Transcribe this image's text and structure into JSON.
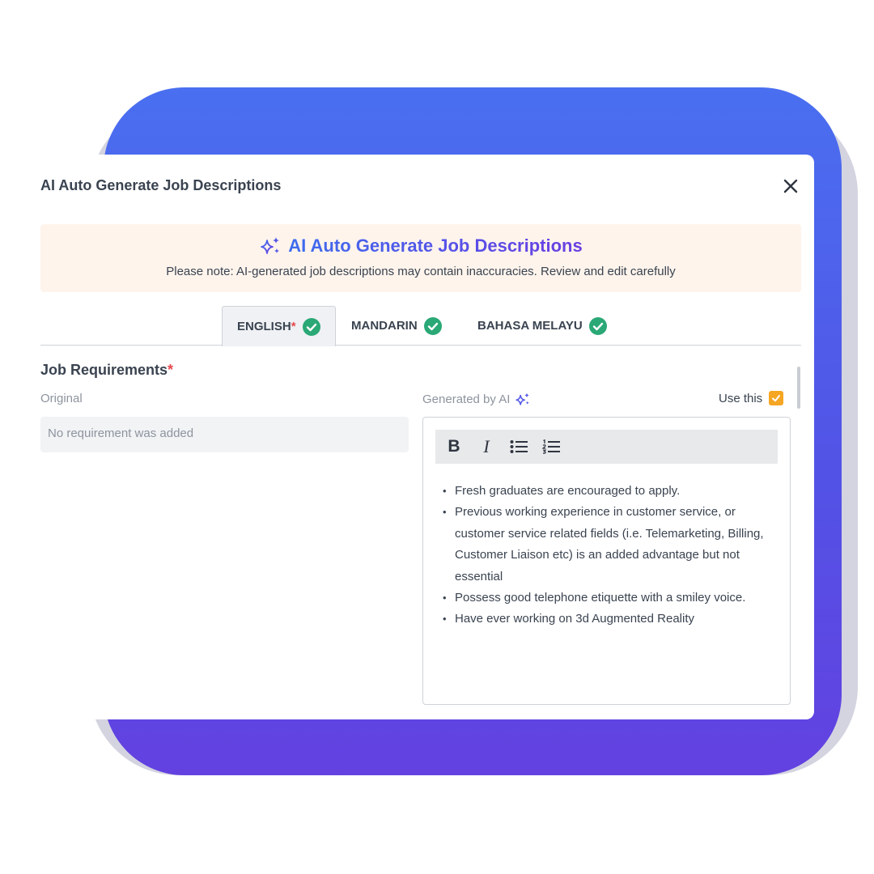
{
  "modal": {
    "title": "AI Auto Generate Job Descriptions",
    "close_icon": "close-icon"
  },
  "banner": {
    "title": "AI Auto Generate Job Descriptions",
    "note": "Please note: AI-generated job descriptions may contain inaccuracies. Review and edit carefully",
    "icon": "sparkles-icon"
  },
  "tabs": [
    {
      "label": "ENGLISH",
      "required_mark": "*",
      "status_icon": "check-circle-icon"
    },
    {
      "label": "MANDARIN",
      "status_icon": "check-circle-icon"
    },
    {
      "label": "BAHASA MELAYU",
      "status_icon": "check-circle-icon"
    }
  ],
  "section": {
    "title": "Job Requirements",
    "required_mark": "*"
  },
  "original": {
    "label": "Original",
    "placeholder": "No requirement was added"
  },
  "generated": {
    "label": "Generated by AI",
    "use_this_label": "Use this",
    "use_this_checked": true,
    "items": [
      "Fresh graduates are encouraged to apply.",
      "Previous working experience in customer service, or customer service related fields (i.e. Telemarketing, Billing, Customer Liaison etc) is an added advantage but not essential",
      "Possess good telephone etiquette with a smiley voice.",
      "Have ever working on 3d Augmented Reality"
    ]
  },
  "toolbar": {
    "bold_label": "B",
    "italic_label": "I"
  },
  "colors": {
    "accent_blue": "#4a6ff0",
    "accent_purple": "#6341e0",
    "check_green": "#2aa876",
    "checkbox_orange": "#f5a623",
    "required_red": "#e5484d",
    "banner_bg": "#fef4ec"
  }
}
